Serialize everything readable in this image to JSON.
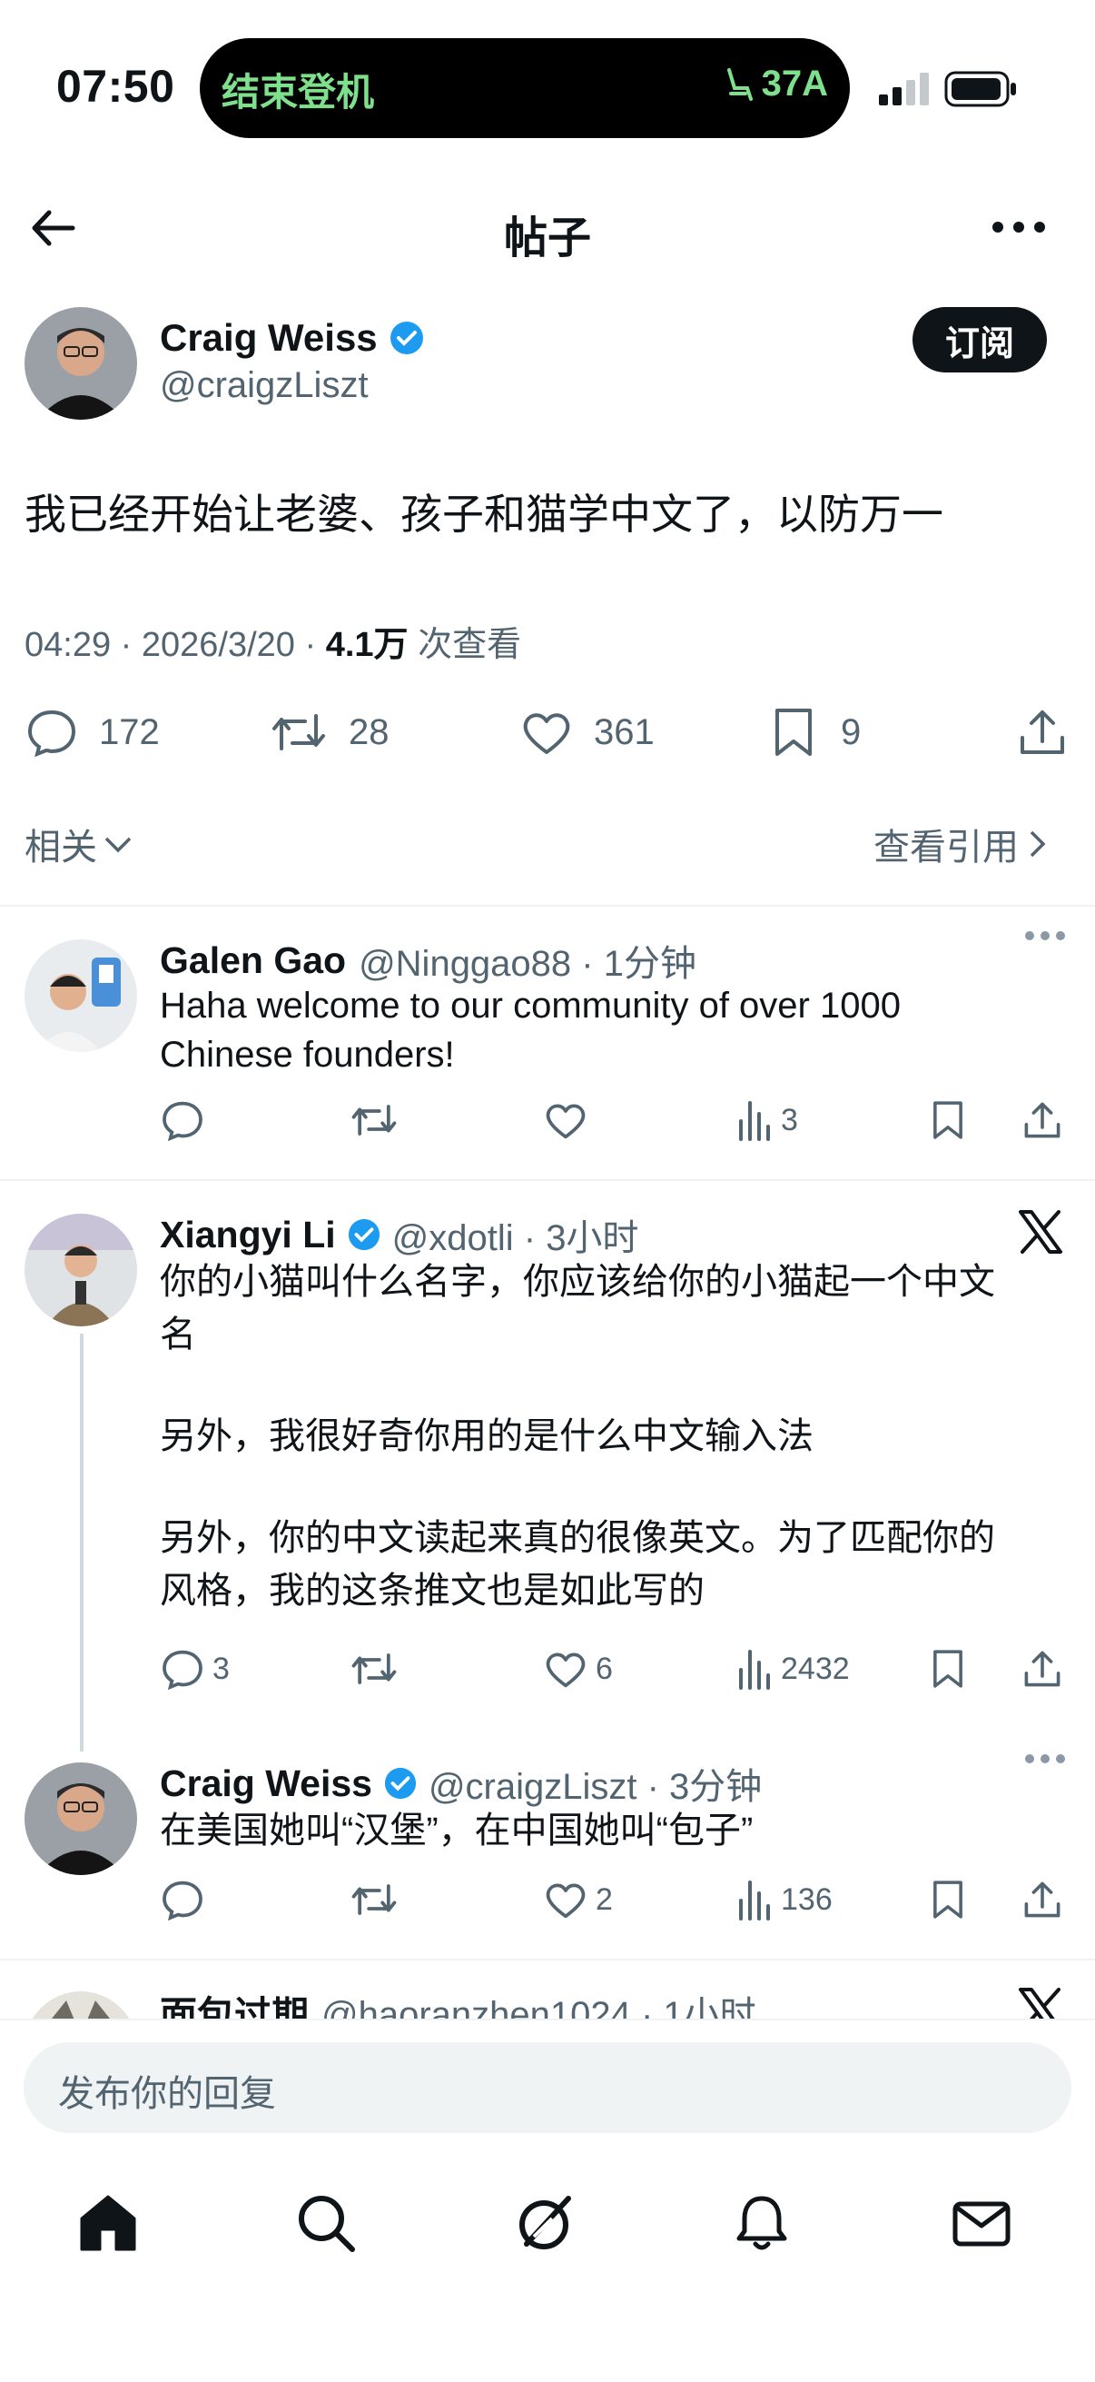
{
  "status_bar": {
    "time": "07:50",
    "island_text": "结束登机",
    "seat": "37A"
  },
  "header": {
    "title": "帖子"
  },
  "post": {
    "author_name": "Craig Weiss",
    "author_handle": "@craigzLiszt",
    "subscribe_label": "订阅",
    "text": "我已经开始让老婆、孩子和猫学中文了，以防万一",
    "time": "04:29 · 2026/3/20 · ",
    "views_count": "4.1万",
    "views_label": " 次查看",
    "replies": "172",
    "reposts": "28",
    "likes": "361",
    "bookmarks": "9",
    "related_label": "相关",
    "quotes_label": "查看引用"
  },
  "replies": [
    {
      "name": "Galen Gao",
      "handle": "@Ninggao88 · 1分钟",
      "text": "Haha  welcome to our community of over 1000 Chinese founders!",
      "views": "3"
    },
    {
      "name": "Xiangyi Li",
      "handle": "@xdotli · 3小时",
      "text_lines": [
        "你的小猫叫什么名字，你应该给你的小猫起一个中文",
        "名",
        "另外，我很好奇你用的是什么中文输入法",
        "另外，你的中文读起来真的很像英文。为了匹配你的",
        "风格，我的这条推文也是如此写的"
      ],
      "replies": "3",
      "likes": "6",
      "views": "2432"
    },
    {
      "name": "Craig Weiss",
      "handle": "@craigzLiszt · 3分钟",
      "text": "在美国她叫“汉堡”，在中国她叫“包子”",
      "likes": "2",
      "views": "136"
    },
    {
      "name": "面包过期",
      "handle": "@haoranzhen1024 · 1小时"
    }
  ],
  "composer": {
    "placeholder": "发布你的回复"
  },
  "colors": {
    "verified": "#1d9bf0",
    "island_green": "#7ee08c",
    "muted": "#536471"
  }
}
